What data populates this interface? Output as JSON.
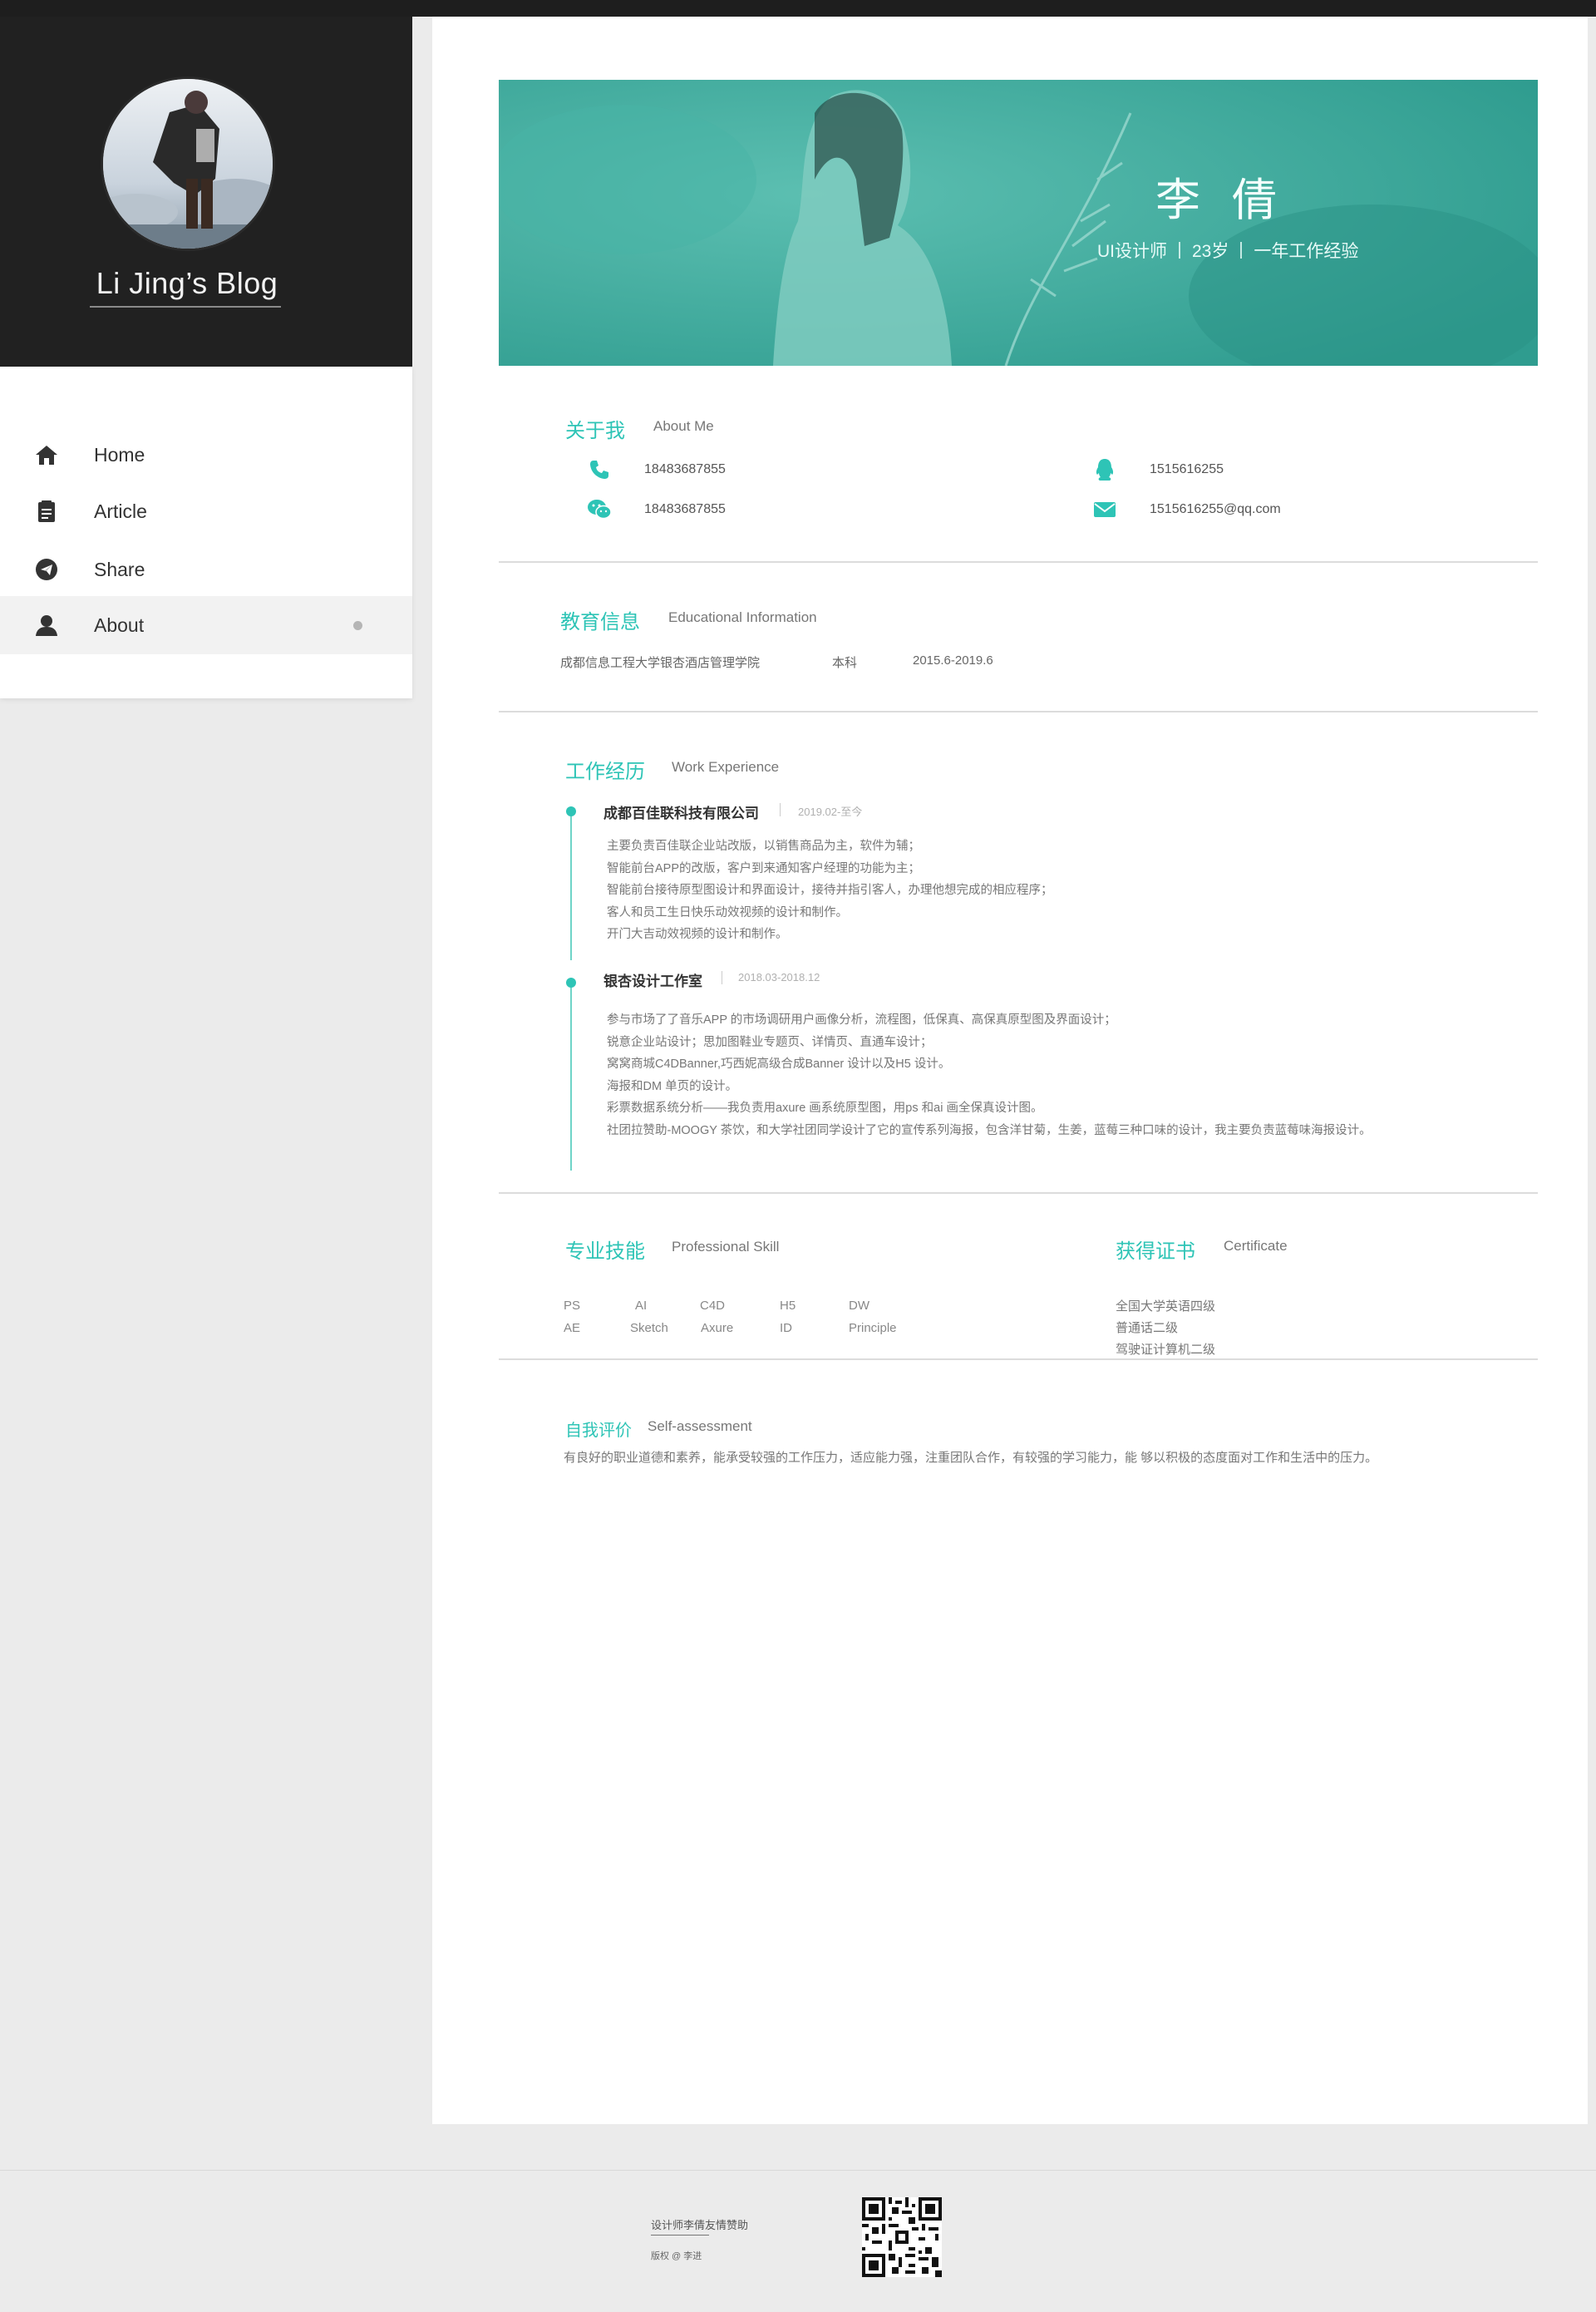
{
  "sidebar": {
    "blog_title": "Li Jing’s Blog",
    "nav": [
      {
        "label": "Home",
        "icon": "home-icon",
        "active": false
      },
      {
        "label": "Article",
        "icon": "article-icon",
        "active": false
      },
      {
        "label": "Share",
        "icon": "share-icon",
        "active": false
      },
      {
        "label": "About",
        "icon": "user-icon",
        "active": true
      }
    ]
  },
  "banner": {
    "name": "李倩",
    "role": "UI设计师",
    "age": "23岁",
    "experience": "一年工作经验"
  },
  "about": {
    "title_cn": "关于我",
    "title_en": "About Me",
    "phone": "18483687855",
    "wechat": "18483687855",
    "qq": "1515616255",
    "email": "1515616255@qq.com"
  },
  "education": {
    "title_cn": "教育信息",
    "title_en": "Educational Information",
    "school": "成都信息工程大学银杏酒店管理学院",
    "degree": "本科",
    "period": "2015.6-2019.6"
  },
  "work": {
    "title_cn": "工作经历",
    "title_en": "Work Experience",
    "jobs": [
      {
        "company": "成都百佳联科技有限公司",
        "period": "2019.02-至今",
        "lines": [
          "主要负责百佳联企业站改版，以销售商品为主，软件为辅；",
          "智能前台APP的改版，客户到来通知客户经理的功能为主；",
          "智能前台接待原型图设计和界面设计，接待并指引客人，办理他想完成的相应程序；",
          "客人和员工生日快乐动效视频的设计和制作。",
          "开门大吉动效视频的设计和制作。"
        ]
      },
      {
        "company": "银杏设计工作室",
        "period": "2018.03-2018.12",
        "lines": [
          "参与市场了了音乐APP 的市场调研用户画像分析，流程图，低保真、高保真原型图及界面设计；",
          "锐意企业站设计；思加图鞋业专题页、详情页、直通车设计；",
          " 窝窝商城C4DBanner,巧西妮高级合成Banner 设计以及H5 设计。",
          " 海报和DM 单页的设计。",
          "彩票数据系统分析——我负责用axure 画系统原型图，用ps 和ai 画全保真设计图。",
          "社团拉赞助-MOOGY 茶饮，和大学社团同学设计了它的宣传系列海报，包含洋甘菊，生姜，蓝莓三种口味的设计，我主要负责蓝莓味海报设计。"
        ]
      }
    ]
  },
  "skills": {
    "title_cn": "专业技能",
    "title_en": "Professional Skill",
    "row1": [
      "PS",
      "AI",
      "C4D",
      "H5",
      "DW"
    ],
    "row2": [
      "AE",
      "Sketch",
      "Axure",
      "ID",
      "Principle"
    ]
  },
  "certificate": {
    "title_cn": "获得证书",
    "title_en": "Certificate",
    "items": [
      "全国大学英语四级",
      "普通话二级",
      "驾驶证计算机二级"
    ]
  },
  "self": {
    "title_cn": "自我评价",
    "title_en": "Self-assessment",
    "text": "有良好的职业道德和素养，能承受较强的工作压力，适应能力强，注重团队合作，有较强的学习能力，能 够以积极的态度面对工作和生活中的压力。"
  },
  "footer": {
    "sponsor": "设计师李倩友情赞助",
    "copyright": "版权 @ 李进"
  },
  "colors": {
    "accent": "#2ec4b6",
    "banner": "#3aa79a",
    "sidebar_dark": "#212121"
  }
}
